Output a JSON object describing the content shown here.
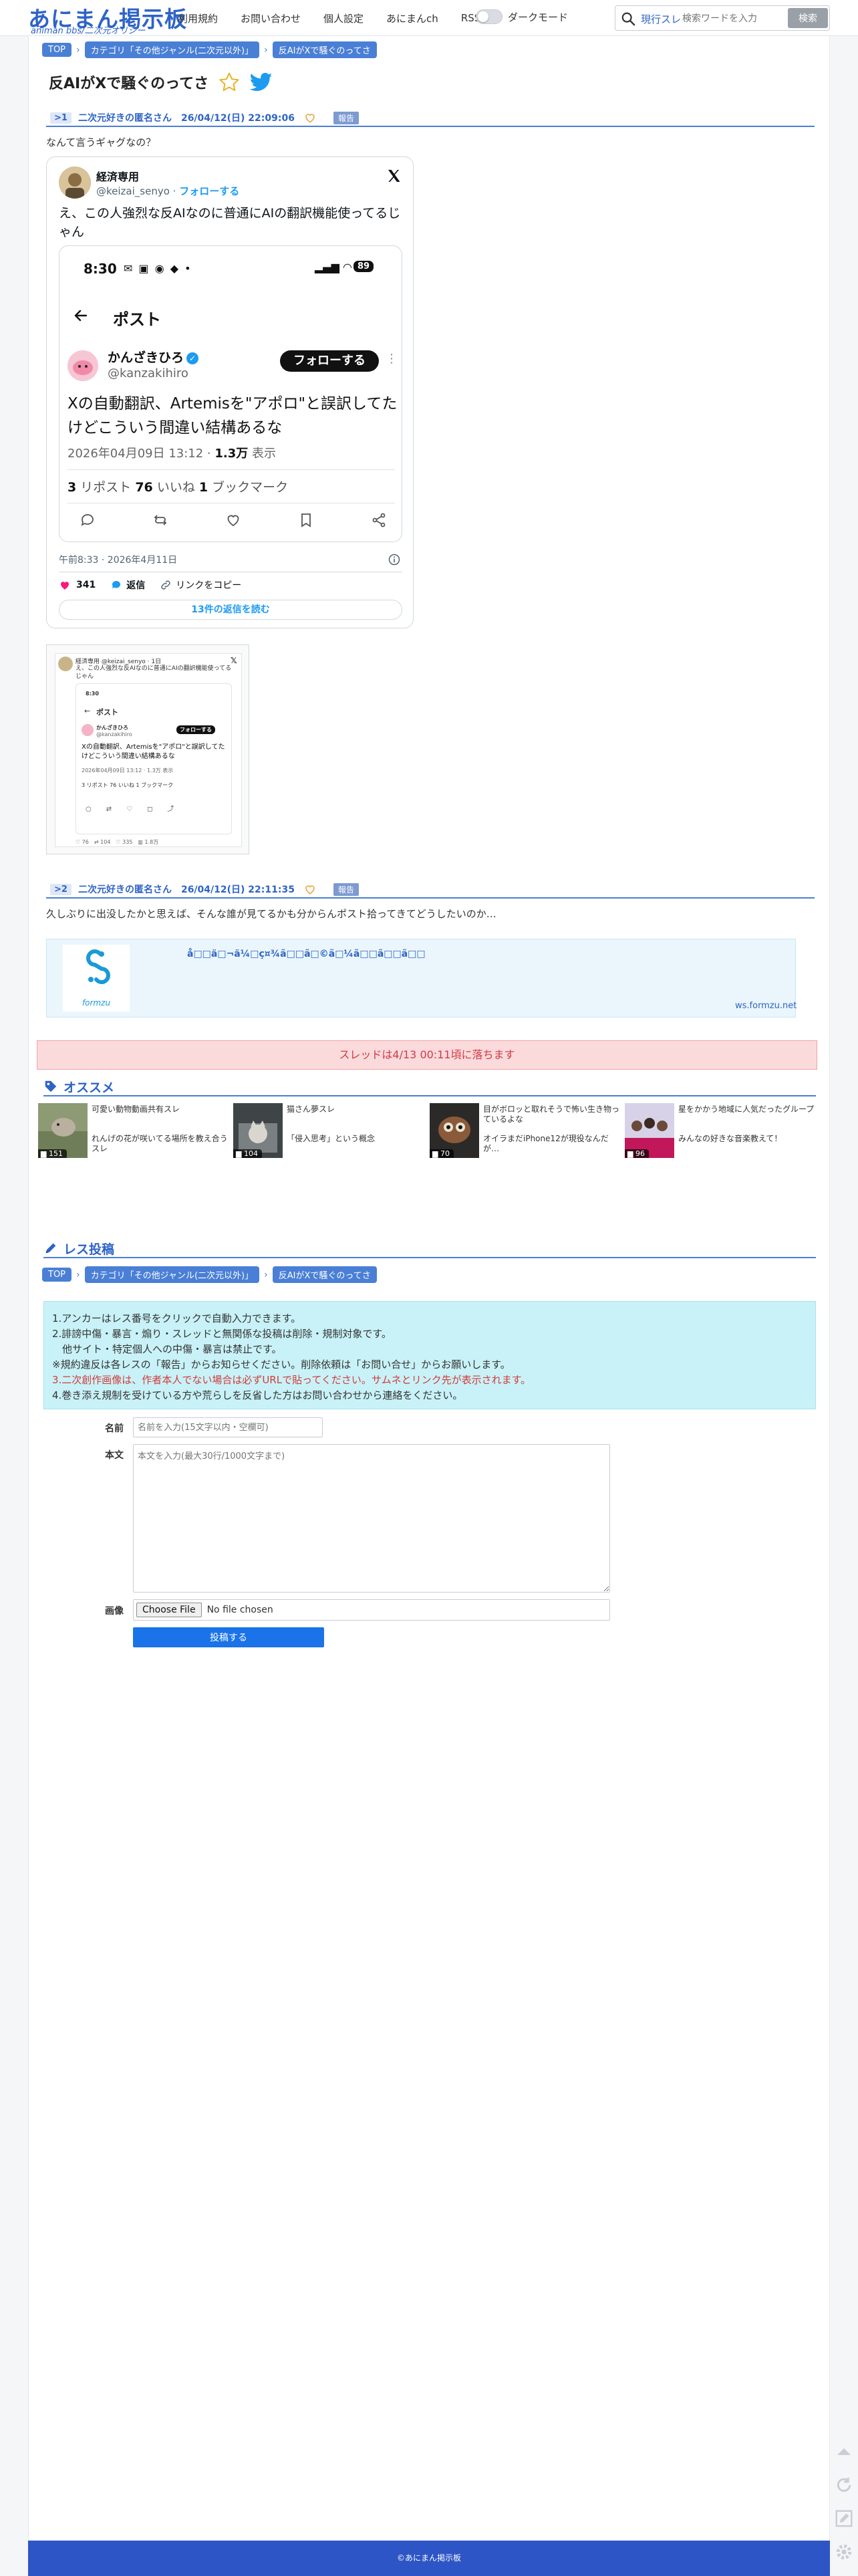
{
  "header": {
    "logo_main": "あにまん掲示板",
    "logo_sub": "animan bbs/二次元オリジー",
    "nav": [
      "利用規約",
      "お問い合わせ",
      "個人設定",
      "あにまんch",
      "RSS"
    ],
    "dark_mode_label": "ダークモード",
    "search_scope": "現行スレ",
    "search_placeholder": "検索ワードを入力",
    "search_button": "検索"
  },
  "breadcrumb": [
    "TOP",
    "カテゴリ「その他ジャンル(二次元以外)」",
    "反AIがXで騒ぐのってさ"
  ],
  "thread": {
    "title": "反AIがXで騒ぐのってさ"
  },
  "posts": [
    {
      "no": ">1",
      "name": "二次元好きの匿名さん",
      "date": "26/04/12(日) 22:09:06",
      "report": "報告",
      "body": "なんて言うギャグなの？"
    },
    {
      "no": ">2",
      "name": "二次元好きの匿名さん",
      "date": "26/04/12(日) 22:11:35",
      "report": "報告",
      "body": "久しぶりに出没したかと思えば、そんな誰が見てるかも分からんポスト拾ってきてどうしたいのか…"
    }
  ],
  "tweet": {
    "name": "経済専用",
    "handle": "@keizai_senyo",
    "follow": "フォローする",
    "text": "え、この人強烈な反AIなのに普通にAIの翻訳機能使ってるじゃん",
    "time": "午前8:33 · 2026年4月11日",
    "likes": "341",
    "reply": "返信",
    "copy_link": "リンクをコピー",
    "read_more": "13件の返信を読む",
    "media": {
      "status_time": "8:30",
      "battery": "89",
      "post_title": "ポスト",
      "name": "かんざきひろ",
      "handle": "@kanzakihiro",
      "follow_button": "フォローする",
      "text": "Xの自動翻訳、Artemisを\"アポロ\"と誤訳してたけどこういう間違い結構あるな",
      "meta_date": "2026年04月09日 13:12 · ",
      "meta_views": "1.3万",
      "meta_views_label": " 表示",
      "reposts": "3",
      "reposts_label": " リポスト  ",
      "likes": "76",
      "likes_label": " いいね  ",
      "bookmarks": "1",
      "bookmarks_label": " ブックマーク"
    }
  },
  "thumb": {
    "name": "経済専用 @keizai_senyo · 1日",
    "text": "え、この人強烈な反AIなのに普通にAIの翻訳機能使ってるじゃん",
    "status_time": "8:30",
    "post_title": "ポスト",
    "inner_name": "かんざきひろ",
    "inner_handle": "@kanzakihiro",
    "inner_follow": "フォローする",
    "inner_text": "Xの自動翻訳、Artemisを\"アポロ\"と誤訳してたけどこういう間違い結構あるな",
    "inner_meta": "2026年04月09日 13:12 · 1.3万 表示",
    "inner_stats": "3 リポスト  76 いいね  1 ブックマーク",
    "foot_replies": "76",
    "foot_reposts": "104",
    "foot_likes": "335",
    "foot_views": "1.8万"
  },
  "link_card": {
    "logo_text": "formzu",
    "title": "å□□ä□¬ä¼□ç¤¾ã□□ã□©ã□¼ã□□ã□□ã□□",
    "domain": "ws.formzu.net"
  },
  "drop_notice": "スレッドは4/13 00:11頃に落ちます",
  "recommend": {
    "title": "オススメ",
    "items": [
      {
        "count": "151",
        "title": "可愛い動物動画共有スレ"
      },
      {
        "count": "104",
        "title": "猫さん夢スレ"
      },
      {
        "count": "70",
        "title": "目がボロッと取れそうで怖い生き物っているよな"
      },
      {
        "count": "96",
        "title": "星をかかう地域に人気だったグループ"
      },
      {
        "count": "99",
        "title": "れんげの花が咲いてる場所を教え合うスレ"
      },
      {
        "count": "97",
        "title": "「侵入思考」という概念"
      },
      {
        "count": "24",
        "title": "オイラまだiPhone12が現役なんだが…"
      },
      {
        "count": "128",
        "title": "みんなの好きな音楽教えて！"
      }
    ]
  },
  "reply_form": {
    "title": "レス投稿",
    "notice_lines": [
      "1.アンカーはレス番号をクリックで自動入力できます。",
      "2.誹謗中傷・暴言・煽り・スレッドと無関係な投稿は削除・規制対象です。",
      "　他サイト・特定個人への中傷・暴言は禁止です。",
      "※規約違反は各レスの「報告」からお知らせください。削除依頼は「お問い合せ」からお願いします。",
      "3.二次創作画像は、作者本人でない場合は必ずURLで貼ってください。サムネとリンク先が表示されます。",
      "4.巻き添え規制を受けている方や荒らしを反省した方はお問い合わせから連絡をください。"
    ],
    "name_label": "名前",
    "name_placeholder": "名前を入力(15文字以内・空欄可)",
    "body_label": "本文",
    "body_placeholder": "本文を入力(最大30行/1000文字まで)",
    "image_label": "画像",
    "file_button": "Choose File",
    "file_status": "No file chosen",
    "submit": "投稿する"
  },
  "footer": "©あにまん掲示板",
  "colors": {
    "accent": "#2e63c8",
    "crumb": "#4a7fd6",
    "notice_bg": "#c8f2f7",
    "drop_bg": "#fbdadc",
    "footer": "#2e55c5"
  }
}
